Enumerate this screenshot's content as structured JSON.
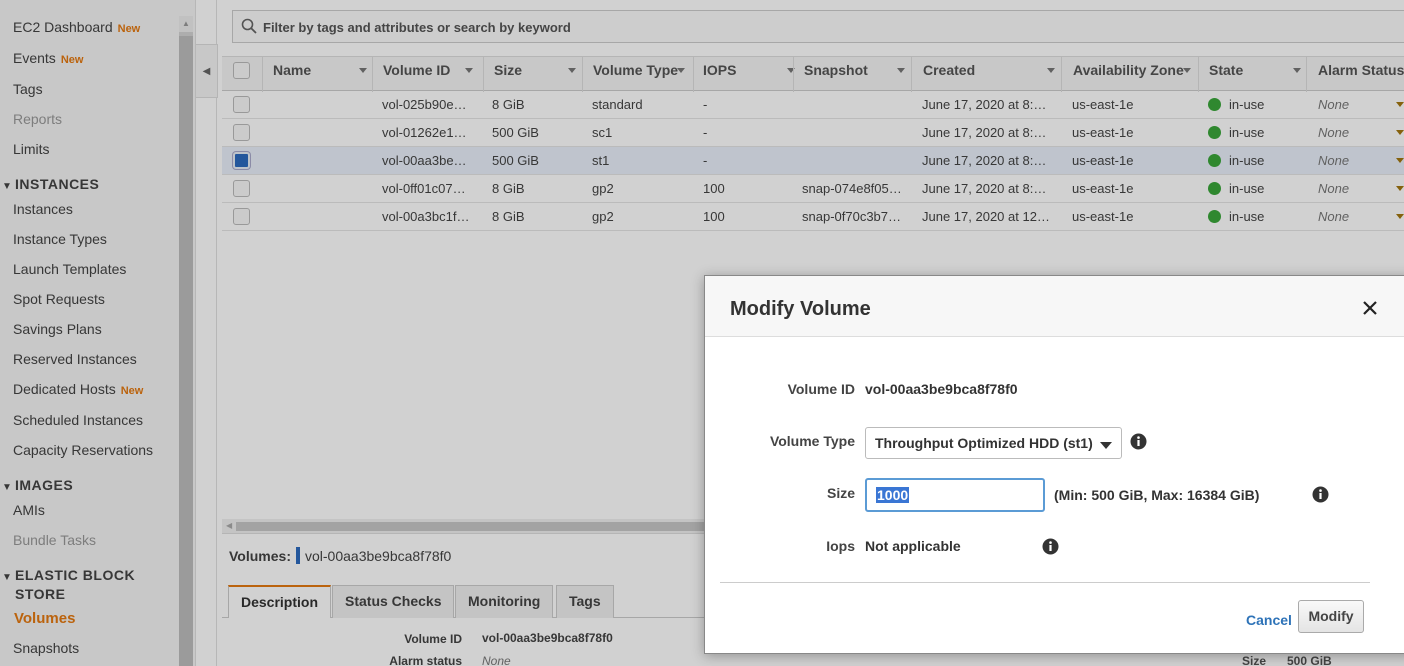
{
  "sidebar": {
    "top_items": [
      {
        "label": "EC2 Dashboard",
        "badge": "New"
      },
      {
        "label": "Events",
        "badge": "New"
      },
      {
        "label": "Tags",
        "badge": ""
      },
      {
        "label": "Reports",
        "badge": ""
      },
      {
        "label": "Limits",
        "badge": ""
      }
    ],
    "instances_header": "INSTANCES",
    "instances_items": [
      {
        "label": "Instances",
        "badge": ""
      },
      {
        "label": "Instance Types",
        "badge": ""
      },
      {
        "label": "Launch Templates",
        "badge": ""
      },
      {
        "label": "Spot Requests",
        "badge": ""
      },
      {
        "label": "Savings Plans",
        "badge": ""
      },
      {
        "label": "Reserved Instances",
        "badge": ""
      },
      {
        "label": "Dedicated Hosts",
        "badge": "New"
      },
      {
        "label": "Scheduled Instances",
        "badge": ""
      },
      {
        "label": "Capacity Reservations",
        "badge": ""
      }
    ],
    "images_header": "IMAGES",
    "images_items": [
      {
        "label": "AMIs",
        "badge": ""
      },
      {
        "label": "Bundle Tasks",
        "badge": ""
      }
    ],
    "ebs_header_line1": "ELASTIC BLOCK",
    "ebs_header_line2": "STORE",
    "ebs_items": [
      {
        "label": "Volumes",
        "badge": ""
      },
      {
        "label": "Snapshots",
        "badge": ""
      }
    ]
  },
  "search": {
    "placeholder": "Filter by tags and attributes or search by keyword"
  },
  "table": {
    "columns": [
      "Name",
      "Volume ID",
      "Size",
      "Volume Type",
      "IOPS",
      "Snapshot",
      "Created",
      "Availability Zone",
      "State",
      "Alarm Status"
    ],
    "rows": [
      {
        "name": "",
        "volume_id": "vol-025b90e…",
        "size": "8 GiB",
        "type": "standard",
        "iops": "-",
        "snapshot": "",
        "created": "June 17, 2020 at 8:…",
        "az": "us-east-1e",
        "state": "in-use",
        "alarm": "None",
        "selected": false
      },
      {
        "name": "",
        "volume_id": "vol-01262e1…",
        "size": "500 GiB",
        "type": "sc1",
        "iops": "-",
        "snapshot": "",
        "created": "June 17, 2020 at 8:…",
        "az": "us-east-1e",
        "state": "in-use",
        "alarm": "None",
        "selected": false
      },
      {
        "name": "",
        "volume_id": "vol-00aa3be…",
        "size": "500 GiB",
        "type": "st1",
        "iops": "-",
        "snapshot": "",
        "created": "June 17, 2020 at 8:…",
        "az": "us-east-1e",
        "state": "in-use",
        "alarm": "None",
        "selected": true
      },
      {
        "name": "",
        "volume_id": "vol-0ff01c07…",
        "size": "8 GiB",
        "type": "gp2",
        "iops": "100",
        "snapshot": "snap-074e8f05…",
        "created": "June 17, 2020 at 8:…",
        "az": "us-east-1e",
        "state": "in-use",
        "alarm": "None",
        "selected": false
      },
      {
        "name": "",
        "volume_id": "vol-00a3bc1f…",
        "size": "8 GiB",
        "type": "gp2",
        "iops": "100",
        "snapshot": "snap-0f70c3b7…",
        "created": "June 17, 2020 at 12…",
        "az": "us-east-1e",
        "state": "in-use",
        "alarm": "None",
        "selected": false
      }
    ]
  },
  "details": {
    "title_label": "Volumes:",
    "title_value": "vol-00aa3be9bca8f78f0",
    "tabs": [
      "Description",
      "Status Checks",
      "Monitoring",
      "Tags"
    ],
    "volume_id_label": "Volume ID",
    "volume_id_value": "vol-00aa3be9bca8f78f0",
    "alarm_label": "Alarm status",
    "alarm_value": "None",
    "size_label": "Size",
    "size_value": "500 GiB"
  },
  "modal": {
    "title": "Modify Volume",
    "volume_id_label": "Volume ID",
    "volume_id_value": "vol-00aa3be9bca8f78f0",
    "volume_type_label": "Volume Type",
    "volume_type_value": "Throughput Optimized HDD (st1)",
    "size_label": "Size",
    "size_value": "1000",
    "size_hint": "(Min: 500 GiB, Max: 16384 GiB)",
    "iops_label": "Iops",
    "iops_value": "Not applicable",
    "cancel_label": "Cancel",
    "modify_label": "Modify"
  },
  "colors": {
    "accent": "#e47911",
    "link": "#2e73b8",
    "status_ok": "#3aa63a",
    "selected_row": "#e9f0fa"
  }
}
